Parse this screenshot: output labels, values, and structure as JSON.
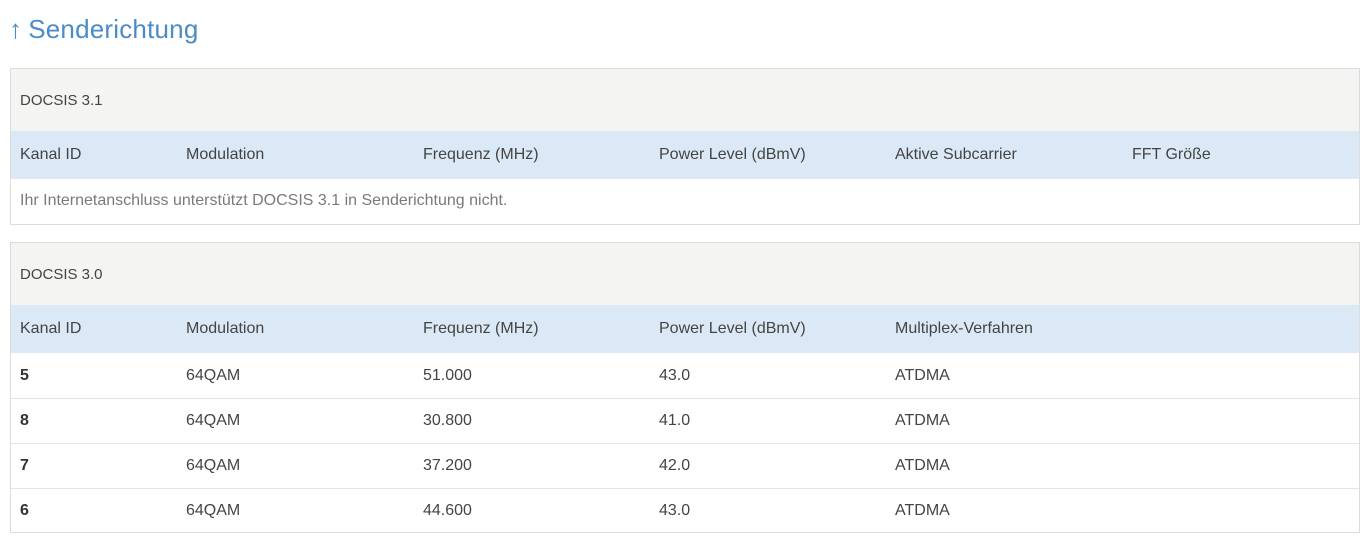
{
  "section": {
    "arrow": "↑",
    "title": "Senderichtung"
  },
  "docsis31": {
    "title": "DOCSIS 3.1",
    "columns": [
      "Kanal ID",
      "Modulation",
      "Frequenz (MHz)",
      "Power Level (dBmV)",
      "Aktive Subcarrier",
      "FFT Größe"
    ],
    "notice": "Ihr Internetanschluss unterstützt DOCSIS 3.1 in Senderichtung nicht."
  },
  "docsis30": {
    "title": "DOCSIS 3.0",
    "columns": [
      "Kanal ID",
      "Modulation",
      "Frequenz (MHz)",
      "Power Level (dBmV)",
      "Multiplex-Verfahren"
    ],
    "rows": [
      [
        "5",
        "64QAM",
        "51.000",
        "43.0",
        "ATDMA"
      ],
      [
        "8",
        "64QAM",
        "30.800",
        "41.0",
        "ATDMA"
      ],
      [
        "7",
        "64QAM",
        "37.200",
        "42.0",
        "ATDMA"
      ],
      [
        "6",
        "64QAM",
        "44.600",
        "43.0",
        "ATDMA"
      ]
    ]
  },
  "colors": {
    "title": "#4a8cc7",
    "header_band": "#dbe9f7",
    "panel_header": "#f4f4f2"
  }
}
